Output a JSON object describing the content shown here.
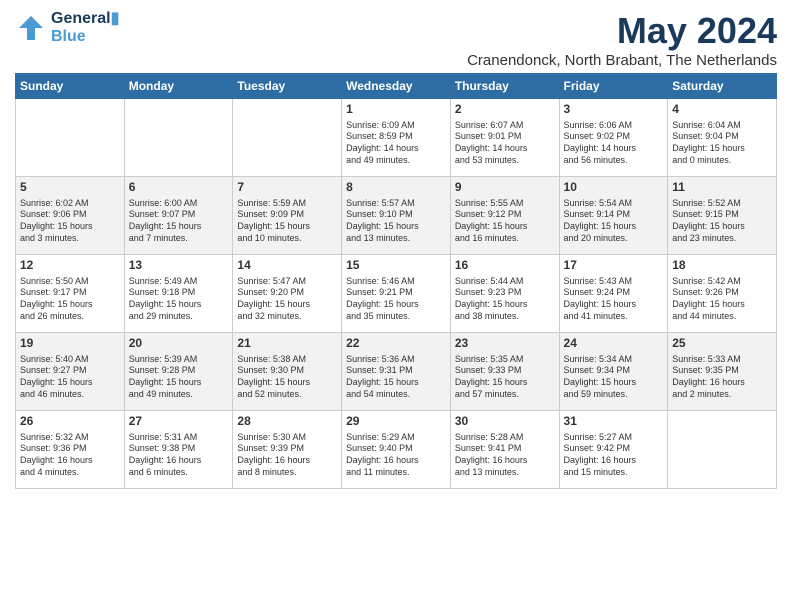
{
  "header": {
    "logo_line1": "General",
    "logo_line2": "Blue",
    "month_title": "May 2024",
    "subtitle": "Cranendonck, North Brabant, The Netherlands"
  },
  "weekdays": [
    "Sunday",
    "Monday",
    "Tuesday",
    "Wednesday",
    "Thursday",
    "Friday",
    "Saturday"
  ],
  "weeks": [
    [
      {
        "day": "",
        "info": ""
      },
      {
        "day": "",
        "info": ""
      },
      {
        "day": "",
        "info": ""
      },
      {
        "day": "1",
        "info": "Sunrise: 6:09 AM\nSunset: 8:59 PM\nDaylight: 14 hours\nand 49 minutes."
      },
      {
        "day": "2",
        "info": "Sunrise: 6:07 AM\nSunset: 9:01 PM\nDaylight: 14 hours\nand 53 minutes."
      },
      {
        "day": "3",
        "info": "Sunrise: 6:06 AM\nSunset: 9:02 PM\nDaylight: 14 hours\nand 56 minutes."
      },
      {
        "day": "4",
        "info": "Sunrise: 6:04 AM\nSunset: 9:04 PM\nDaylight: 15 hours\nand 0 minutes."
      }
    ],
    [
      {
        "day": "5",
        "info": "Sunrise: 6:02 AM\nSunset: 9:06 PM\nDaylight: 15 hours\nand 3 minutes."
      },
      {
        "day": "6",
        "info": "Sunrise: 6:00 AM\nSunset: 9:07 PM\nDaylight: 15 hours\nand 7 minutes."
      },
      {
        "day": "7",
        "info": "Sunrise: 5:59 AM\nSunset: 9:09 PM\nDaylight: 15 hours\nand 10 minutes."
      },
      {
        "day": "8",
        "info": "Sunrise: 5:57 AM\nSunset: 9:10 PM\nDaylight: 15 hours\nand 13 minutes."
      },
      {
        "day": "9",
        "info": "Sunrise: 5:55 AM\nSunset: 9:12 PM\nDaylight: 15 hours\nand 16 minutes."
      },
      {
        "day": "10",
        "info": "Sunrise: 5:54 AM\nSunset: 9:14 PM\nDaylight: 15 hours\nand 20 minutes."
      },
      {
        "day": "11",
        "info": "Sunrise: 5:52 AM\nSunset: 9:15 PM\nDaylight: 15 hours\nand 23 minutes."
      }
    ],
    [
      {
        "day": "12",
        "info": "Sunrise: 5:50 AM\nSunset: 9:17 PM\nDaylight: 15 hours\nand 26 minutes."
      },
      {
        "day": "13",
        "info": "Sunrise: 5:49 AM\nSunset: 9:18 PM\nDaylight: 15 hours\nand 29 minutes."
      },
      {
        "day": "14",
        "info": "Sunrise: 5:47 AM\nSunset: 9:20 PM\nDaylight: 15 hours\nand 32 minutes."
      },
      {
        "day": "15",
        "info": "Sunrise: 5:46 AM\nSunset: 9:21 PM\nDaylight: 15 hours\nand 35 minutes."
      },
      {
        "day": "16",
        "info": "Sunrise: 5:44 AM\nSunset: 9:23 PM\nDaylight: 15 hours\nand 38 minutes."
      },
      {
        "day": "17",
        "info": "Sunrise: 5:43 AM\nSunset: 9:24 PM\nDaylight: 15 hours\nand 41 minutes."
      },
      {
        "day": "18",
        "info": "Sunrise: 5:42 AM\nSunset: 9:26 PM\nDaylight: 15 hours\nand 44 minutes."
      }
    ],
    [
      {
        "day": "19",
        "info": "Sunrise: 5:40 AM\nSunset: 9:27 PM\nDaylight: 15 hours\nand 46 minutes."
      },
      {
        "day": "20",
        "info": "Sunrise: 5:39 AM\nSunset: 9:28 PM\nDaylight: 15 hours\nand 49 minutes."
      },
      {
        "day": "21",
        "info": "Sunrise: 5:38 AM\nSunset: 9:30 PM\nDaylight: 15 hours\nand 52 minutes."
      },
      {
        "day": "22",
        "info": "Sunrise: 5:36 AM\nSunset: 9:31 PM\nDaylight: 15 hours\nand 54 minutes."
      },
      {
        "day": "23",
        "info": "Sunrise: 5:35 AM\nSunset: 9:33 PM\nDaylight: 15 hours\nand 57 minutes."
      },
      {
        "day": "24",
        "info": "Sunrise: 5:34 AM\nSunset: 9:34 PM\nDaylight: 15 hours\nand 59 minutes."
      },
      {
        "day": "25",
        "info": "Sunrise: 5:33 AM\nSunset: 9:35 PM\nDaylight: 16 hours\nand 2 minutes."
      }
    ],
    [
      {
        "day": "26",
        "info": "Sunrise: 5:32 AM\nSunset: 9:36 PM\nDaylight: 16 hours\nand 4 minutes."
      },
      {
        "day": "27",
        "info": "Sunrise: 5:31 AM\nSunset: 9:38 PM\nDaylight: 16 hours\nand 6 minutes."
      },
      {
        "day": "28",
        "info": "Sunrise: 5:30 AM\nSunset: 9:39 PM\nDaylight: 16 hours\nand 8 minutes."
      },
      {
        "day": "29",
        "info": "Sunrise: 5:29 AM\nSunset: 9:40 PM\nDaylight: 16 hours\nand 11 minutes."
      },
      {
        "day": "30",
        "info": "Sunrise: 5:28 AM\nSunset: 9:41 PM\nDaylight: 16 hours\nand 13 minutes."
      },
      {
        "day": "31",
        "info": "Sunrise: 5:27 AM\nSunset: 9:42 PM\nDaylight: 16 hours\nand 15 minutes."
      },
      {
        "day": "",
        "info": ""
      }
    ]
  ]
}
